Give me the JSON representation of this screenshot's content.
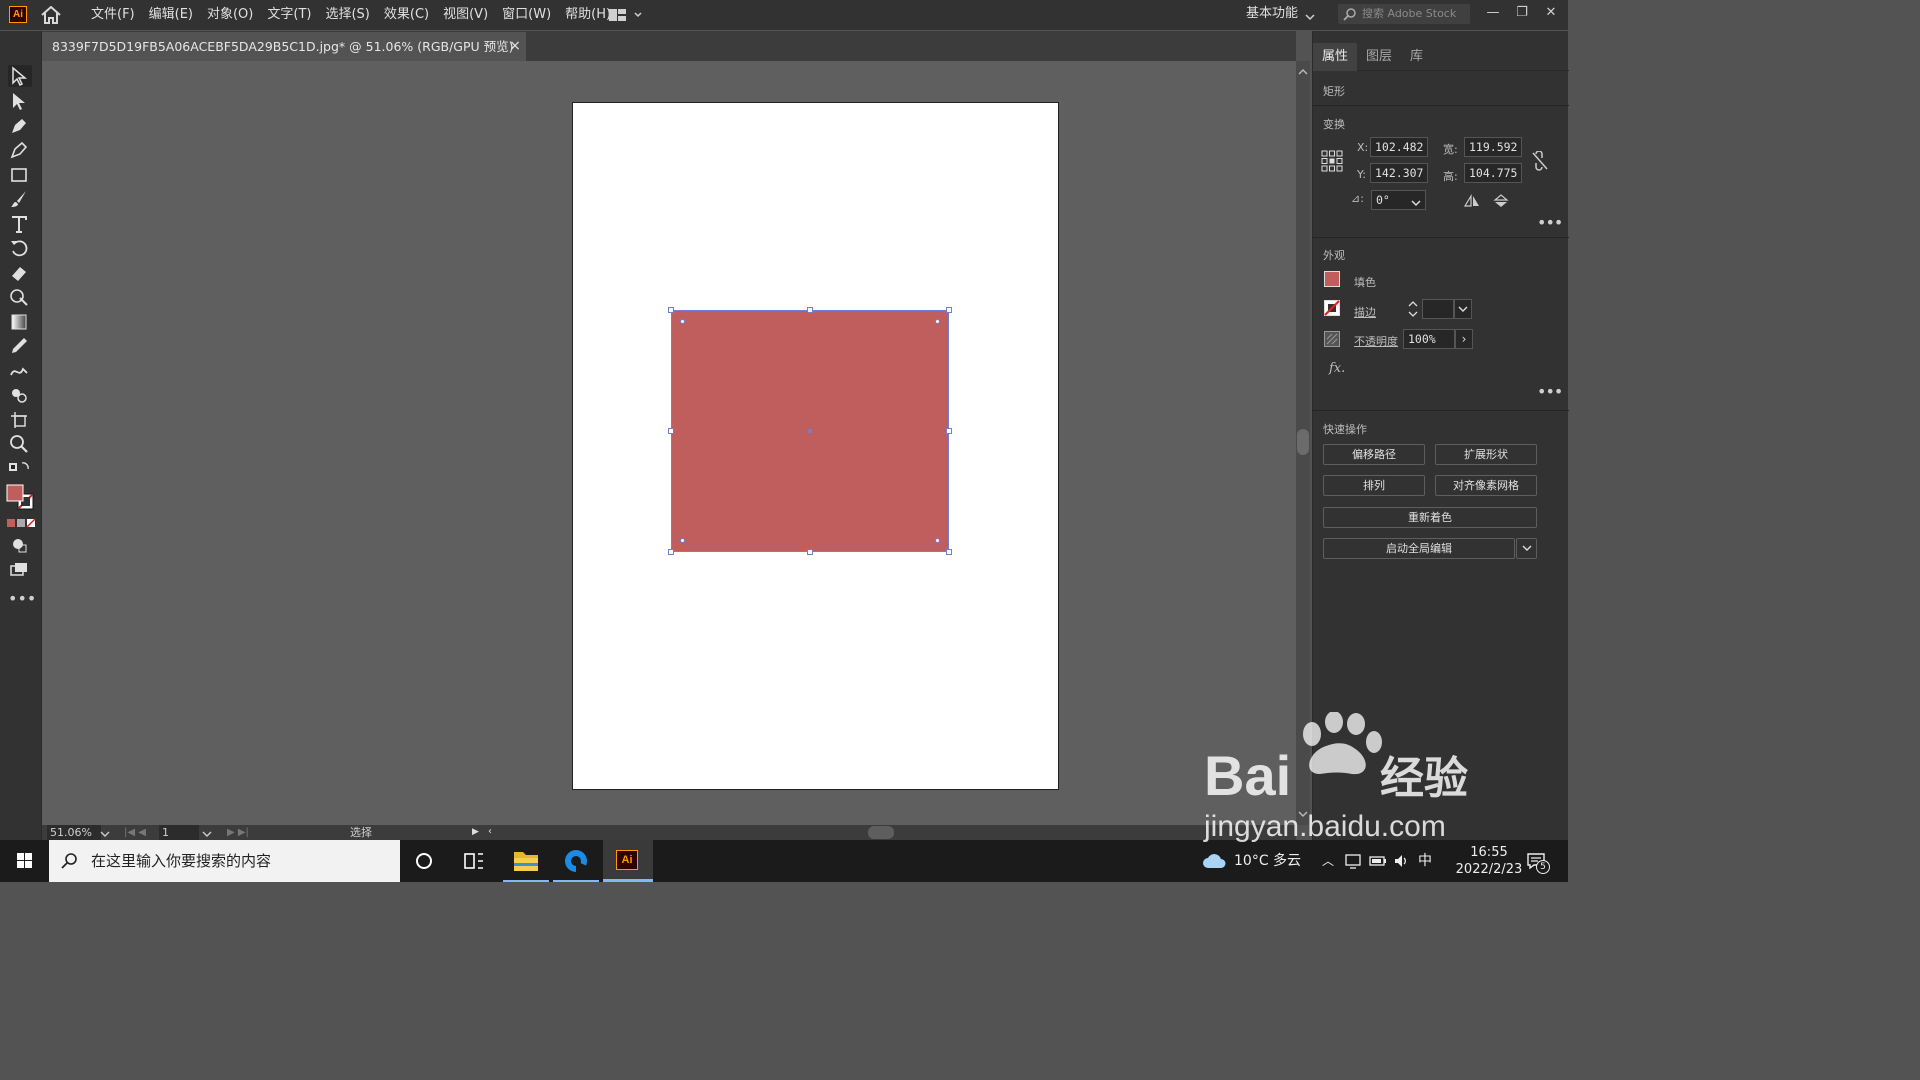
{
  "app": {
    "logo_text": "Ai"
  },
  "menubar": {
    "items": [
      "文件(F)",
      "编辑(E)",
      "对象(O)",
      "文字(T)",
      "选择(S)",
      "效果(C)",
      "视图(V)",
      "窗口(W)",
      "帮助(H)"
    ],
    "workspace_label": "基本功能",
    "stock_placeholder": "搜索 Adobe Stock"
  },
  "document": {
    "tab_title": "8339F7D5D19FB5A06ACEBF5DA29B5C1D.jpg* @ 51.06% (RGB/GPU 预览)",
    "close_glyph": "×"
  },
  "shape": {
    "fill_color": "#c05e5e"
  },
  "status": {
    "zoom": "51.06%",
    "page": "1",
    "tool_mode": "选择"
  },
  "panel": {
    "tabs": [
      "属性",
      "图层",
      "库"
    ],
    "object_type": "矩形",
    "transform": {
      "section_label": "变换",
      "x_label": "X:",
      "x": "102.482",
      "y_label": "Y:",
      "y": "142.307",
      "w_label": "宽:",
      "w": "119.592",
      "h_label": "高:",
      "h": "104.775",
      "angle_label": "⊿:",
      "angle": "0°"
    },
    "appearance": {
      "section_label": "外观",
      "fill_label": "填色",
      "stroke_label": "描边",
      "opacity_label": "不透明度",
      "opacity": "100%",
      "fx_label": "fx."
    },
    "quick_actions": {
      "section_label": "快速操作",
      "offset_path": "偏移路径",
      "expand_shape": "扩展形状",
      "arrange": "排列",
      "align_pixel_grid": "对齐像素网格",
      "recolor": "重新着色",
      "global_edit": "启动全局编辑"
    }
  },
  "taskbar": {
    "search_placeholder": "在这里输入你要搜索的内容",
    "weather": "10°C 多云",
    "ime": "中",
    "time": "16:55",
    "date": "2022/2/23",
    "notification_count": "5",
    "ai_label": "Ai"
  },
  "watermark": {
    "brand": "Bai",
    "brand2": "经验",
    "url": "jingyan.baidu.com"
  }
}
